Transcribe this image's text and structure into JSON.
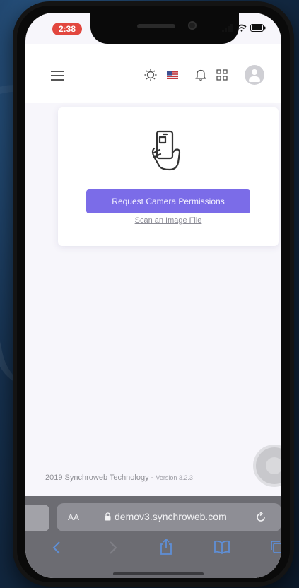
{
  "status": {
    "time": "2:38",
    "icons": [
      "signal-icon",
      "wifi-icon",
      "battery-icon"
    ]
  },
  "header": {
    "icons": [
      "hamburger-menu-icon",
      "brightness-icon",
      "us-flag-icon",
      "bell-icon",
      "grid-apps-icon",
      "avatar-icon"
    ]
  },
  "card": {
    "icon": "phone-in-hand-icon",
    "request_button_label": "Request Camera Permissions",
    "scan_link_label": "Scan an Image File"
  },
  "footer": {
    "copyright": "2019 Synchroweb Technology - ",
    "version": "Version 3.2.3"
  },
  "browser": {
    "text_size_label": "AA",
    "url": "demov3.synchroweb.com",
    "nav_icons": [
      "back-icon",
      "forward-icon",
      "share-icon",
      "bookmarks-icon",
      "tabs-icon"
    ]
  },
  "colors": {
    "accent": "#7b6ce8",
    "time_pill": "#e2473f",
    "safari_bar": "#6c6c72"
  }
}
